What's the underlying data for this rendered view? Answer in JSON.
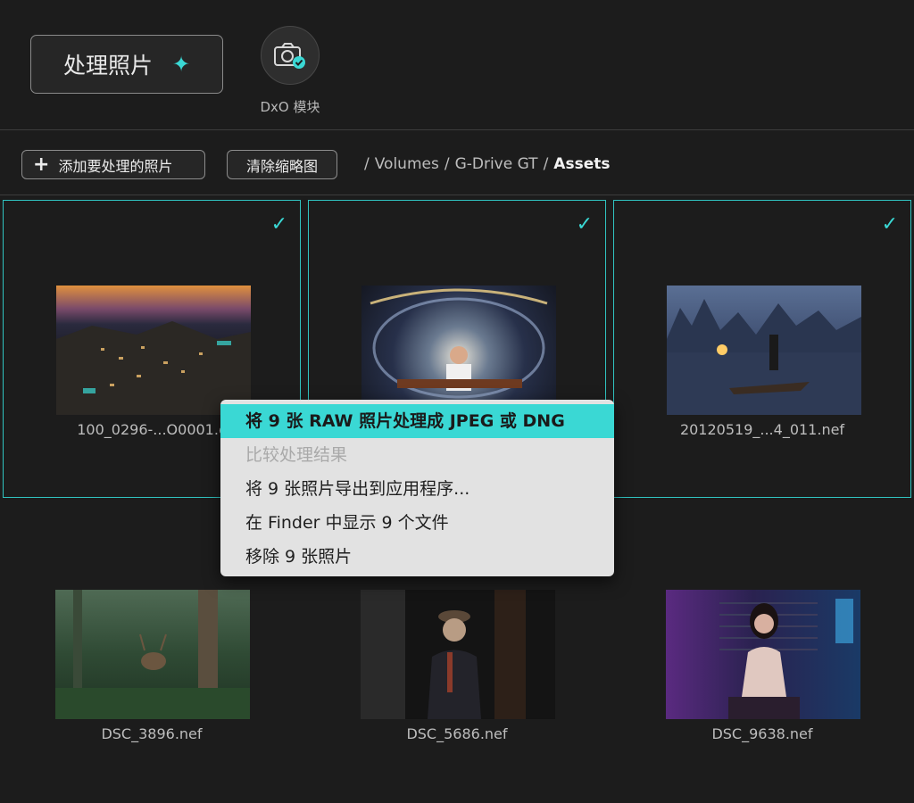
{
  "header": {
    "process_button_label": "处理照片",
    "module_label": "DxO 模块"
  },
  "toolbar": {
    "add_button_label": "添加要处理的照片",
    "clear_button_label": "清除缩略图",
    "breadcrumb": {
      "sep": "/",
      "part1": "Volumes",
      "part2": "G-Drive GT",
      "current": "Assets"
    }
  },
  "thumbnails": [
    {
      "filename": "100_0296-...O0001.c",
      "selected": true
    },
    {
      "filename": "",
      "selected": true
    },
    {
      "filename": "20120519_...4_011.nef",
      "selected": true
    },
    {
      "filename": "DSC_3896.nef",
      "selected": false
    },
    {
      "filename": "DSC_5686.nef",
      "selected": false
    },
    {
      "filename": "DSC_9638.nef",
      "selected": false
    }
  ],
  "context_menu": {
    "items": [
      {
        "label": "将 9 张 RAW 照片处理成 JPEG 或 DNG",
        "state": "active"
      },
      {
        "label": "比较处理结果",
        "state": "disabled"
      },
      {
        "label": "将 9 张照片导出到应用程序...",
        "state": "normal"
      },
      {
        "label": "在 Finder 中显示 9 个文件",
        "state": "normal"
      },
      {
        "label": "移除 9 张照片",
        "state": "normal"
      }
    ]
  },
  "colors": {
    "accent": "#3ad8d4",
    "background": "#1c1c1c",
    "menu_bg": "#e2e2e2"
  }
}
